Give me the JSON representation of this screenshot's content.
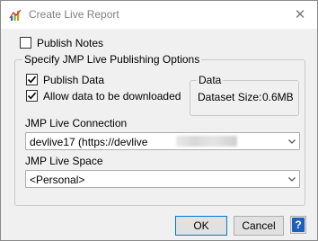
{
  "window": {
    "title": "Create Live Report",
    "close_glyph": "✕"
  },
  "publish_notes": {
    "label": "Publish Notes",
    "checked": false
  },
  "options_group": {
    "legend": "Specify JMP Live Publishing Options",
    "publish_data": {
      "label": "Publish Data",
      "checked": true
    },
    "allow_download": {
      "label": "Allow data to be downloaded",
      "checked": true
    },
    "data_group": {
      "legend": "Data",
      "size_label": "Dataset Size:",
      "size_value": "0.6MB"
    },
    "connection": {
      "label": "JMP Live Connection",
      "value": "devlive17 (https://devlive"
    },
    "space": {
      "label": "JMP Live Space",
      "value": "<Personal>"
    }
  },
  "buttons": {
    "ok": "OK",
    "cancel": "Cancel",
    "help": "?"
  },
  "icons": {
    "app": "jmp-app-icon",
    "close": "close-icon",
    "check": "check-icon",
    "chevron": "chevron-down-icon",
    "help": "help-icon"
  },
  "colors": {
    "accent": "#0078d7",
    "help_blue": "#1c5fbd"
  }
}
